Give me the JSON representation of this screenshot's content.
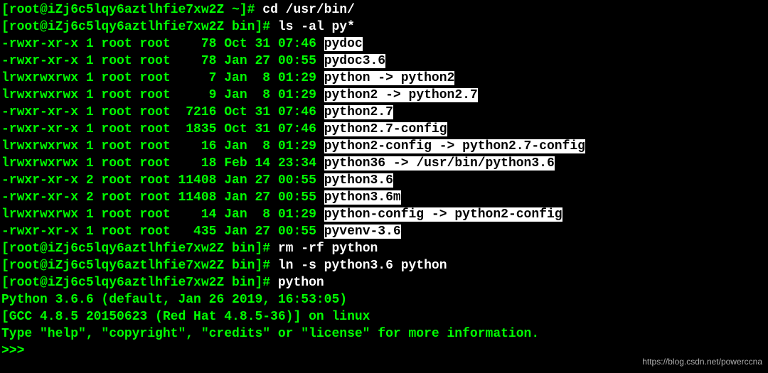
{
  "prompts": {
    "p1_host": "[root@iZj6c5lqy6aztlhfie7xw2Z ~]# ",
    "p2_host": "[root@iZj6c5lqy6aztlhfie7xw2Z bin]# ",
    "cmd1": "cd /usr/bin/",
    "cmd2": "ls -al py*",
    "cmd3": "rm -rf python",
    "cmd4": "ln -s python3.6 python",
    "cmd5": "python"
  },
  "ls": [
    {
      "perm": "-rwxr-xr-x 1 root root    78 Oct 31 07:46 ",
      "name": "pydoc",
      "link": "",
      "target": ""
    },
    {
      "perm": "-rwxr-xr-x 1 root root    78 Jan 27 00:55 ",
      "name": "pydoc3.6",
      "link": "",
      "target": ""
    },
    {
      "perm": "lrwxrwxrwx 1 root root     7 Jan  8 01:29 ",
      "name": "python",
      "link": " -> ",
      "target": "python2"
    },
    {
      "perm": "lrwxrwxrwx 1 root root     9 Jan  8 01:29 ",
      "name": "python2",
      "link": " -> ",
      "target": "python2.7"
    },
    {
      "perm": "-rwxr-xr-x 1 root root  7216 Oct 31 07:46 ",
      "name": "python2.7",
      "link": "",
      "target": ""
    },
    {
      "perm": "-rwxr-xr-x 1 root root  1835 Oct 31 07:46 ",
      "name": "python2.7-config",
      "link": "",
      "target": ""
    },
    {
      "perm": "lrwxrwxrwx 1 root root    16 Jan  8 01:29 ",
      "name": "python2-config",
      "link": " -> ",
      "target": "python2.7-config"
    },
    {
      "perm": "lrwxrwxrwx 1 root root    18 Feb 14 23:34 ",
      "name": "python36",
      "link": " -> ",
      "target": "/usr/bin/python3.6"
    },
    {
      "perm": "-rwxr-xr-x 2 root root 11408 Jan 27 00:55 ",
      "name": "python3.6",
      "link": "",
      "target": ""
    },
    {
      "perm": "-rwxr-xr-x 2 root root 11408 Jan 27 00:55 ",
      "name": "python3.6m",
      "link": "",
      "target": ""
    },
    {
      "perm": "lrwxrwxrwx 1 root root    14 Jan  8 01:29 ",
      "name": "python-config",
      "link": " -> ",
      "target": "python2-config"
    },
    {
      "perm": "-rwxr-xr-x 1 root root   435 Jan 27 00:55 ",
      "name": "pyvenv-3.6",
      "link": "",
      "target": ""
    }
  ],
  "pyout": {
    "l1": "Python 3.6.6 (default, Jan 26 2019, 16:53:05)",
    "l2": "[GCC 4.8.5 20150623 (Red Hat 4.8.5-36)] on linux",
    "l3": "Type \"help\", \"copyright\", \"credits\" or \"license\" for more information.",
    "l4": ">>>"
  },
  "watermark": "https://blog.csdn.net/powerccna"
}
